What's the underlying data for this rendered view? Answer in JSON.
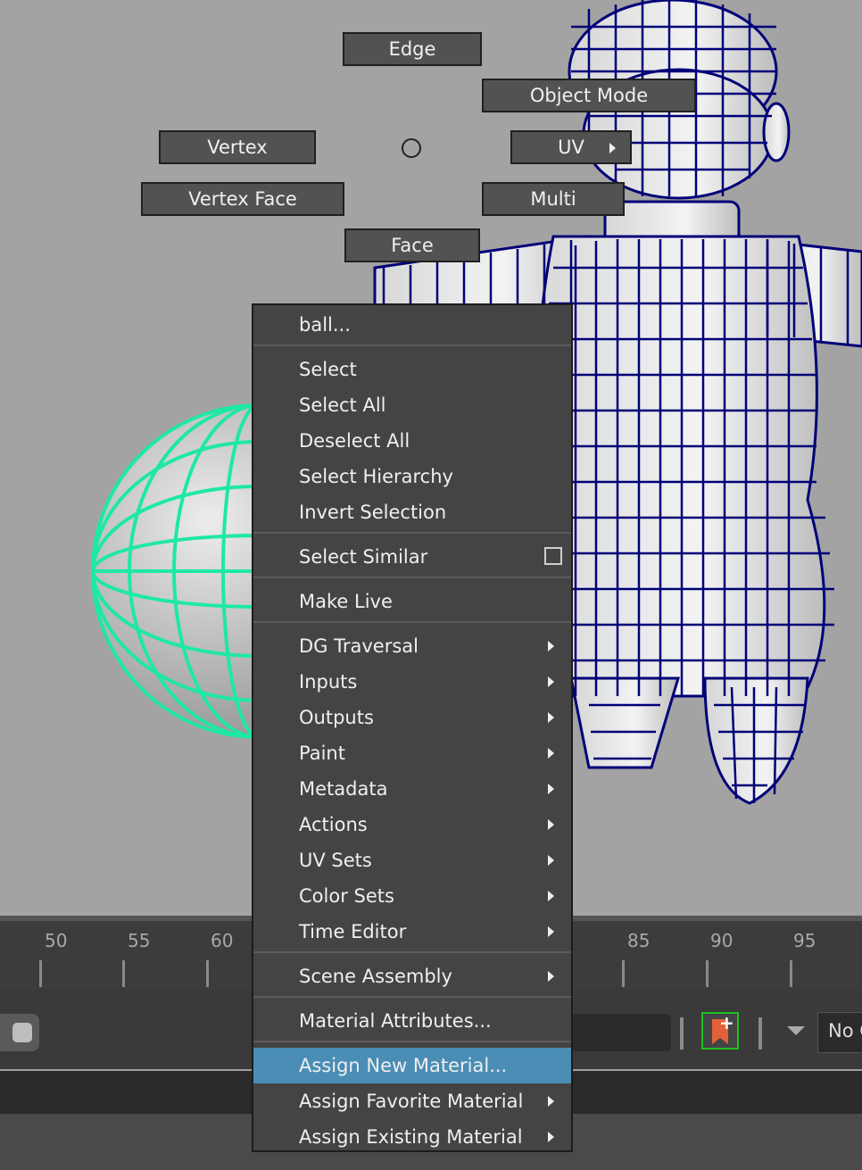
{
  "marking_menu": {
    "edge": "Edge",
    "object_mode": "Object Mode",
    "vertex": "Vertex",
    "uv": "UV",
    "vertex_face": "Vertex Face",
    "multi": "Multi",
    "face": "Face"
  },
  "timeline": {
    "ticks": [
      "50",
      "55",
      "60",
      "85",
      "90",
      "95"
    ]
  },
  "playback": {
    "no_character_field": "No C"
  },
  "context_menu": {
    "object_name": "ball...",
    "items": [
      "Select",
      "Select All",
      "Deselect All",
      "Select Hierarchy",
      "Invert Selection",
      "Select Similar",
      "Make Live",
      "DG Traversal",
      "Inputs",
      "Outputs",
      "Paint",
      "Metadata",
      "Actions",
      "UV Sets",
      "Color Sets",
      "Time Editor",
      "Scene Assembly",
      "Material Attributes...",
      "Assign New Material...",
      "Assign Favorite Material",
      "Assign Existing Material"
    ],
    "highlighted_item": "Assign New Material..."
  },
  "colors": {
    "highlight": "#4a8db5",
    "selected_wireframe": "#1ee8a6",
    "character_wireframe": "#000078"
  }
}
